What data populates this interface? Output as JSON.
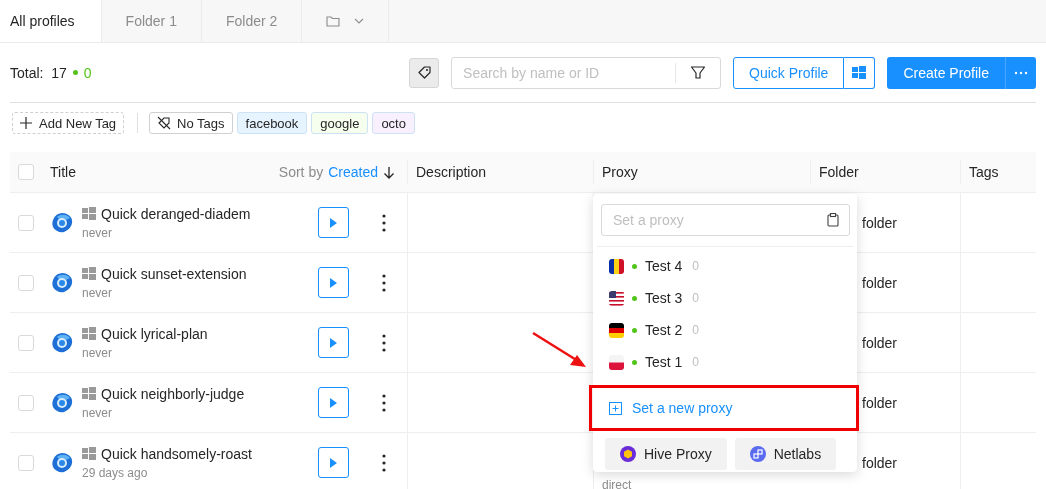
{
  "tabs": [
    {
      "label": "All profiles",
      "selected": true
    },
    {
      "label": "Folder 1",
      "selected": false
    },
    {
      "label": "Folder 2",
      "selected": false
    }
  ],
  "total": {
    "label": "Total:",
    "count": "17",
    "online": "0"
  },
  "search": {
    "placeholder": "Search by name or ID"
  },
  "quick_profile_button": "Quick Profile",
  "create_profile_button": "Create Profile",
  "add_tag_button": "Add New Tag",
  "tag_filters": [
    {
      "label": "No Tags",
      "kind": "none"
    },
    {
      "label": "facebook",
      "kind": "tag",
      "color": "#e6f4ff"
    },
    {
      "label": "google",
      "kind": "tag",
      "color": "#f6ffed"
    },
    {
      "label": "octo",
      "kind": "tag",
      "color": "#f9f0ff"
    }
  ],
  "table": {
    "columns": {
      "title": "Title",
      "sort_label": "Sort by",
      "sort_field": "Created",
      "description": "Description",
      "proxy": "Proxy",
      "folder": "Folder",
      "tags": "Tags"
    },
    "select_all_checked": false,
    "rows": [
      {
        "checked": false,
        "name": "Quick deranged-diadem",
        "last_run": "never",
        "folder": "folder"
      },
      {
        "checked": false,
        "name": "Quick sunset-extension",
        "last_run": "never",
        "folder": "folder"
      },
      {
        "checked": false,
        "name": "Quick lyrical-plan",
        "last_run": "never",
        "folder": "folder"
      },
      {
        "checked": false,
        "name": "Quick neighborly-judge",
        "last_run": "never",
        "folder": "folder"
      },
      {
        "checked": false,
        "name": "Quick handsomely-roast",
        "last_run": "29 days ago",
        "folder": "folder",
        "proxy": "direct"
      }
    ]
  },
  "proxy_dropdown": {
    "placeholder": "Set a proxy",
    "proxies": [
      {
        "name": "Test 4",
        "count": "0",
        "online": true,
        "kind": "ro"
      },
      {
        "name": "Test 3",
        "count": "0",
        "online": true,
        "kind": "us"
      },
      {
        "name": "Test 2",
        "count": "0",
        "online": true,
        "kind": "de"
      },
      {
        "name": "Test 1",
        "count": "0",
        "online": true,
        "kind": "pl"
      }
    ],
    "new_proxy": {
      "label": "Set a new proxy",
      "highlighted": true
    },
    "providers": [
      {
        "label": "Hive Proxy",
        "kind": "hive"
      },
      {
        "label": "Netlabs",
        "kind": "netlabs"
      }
    ]
  }
}
